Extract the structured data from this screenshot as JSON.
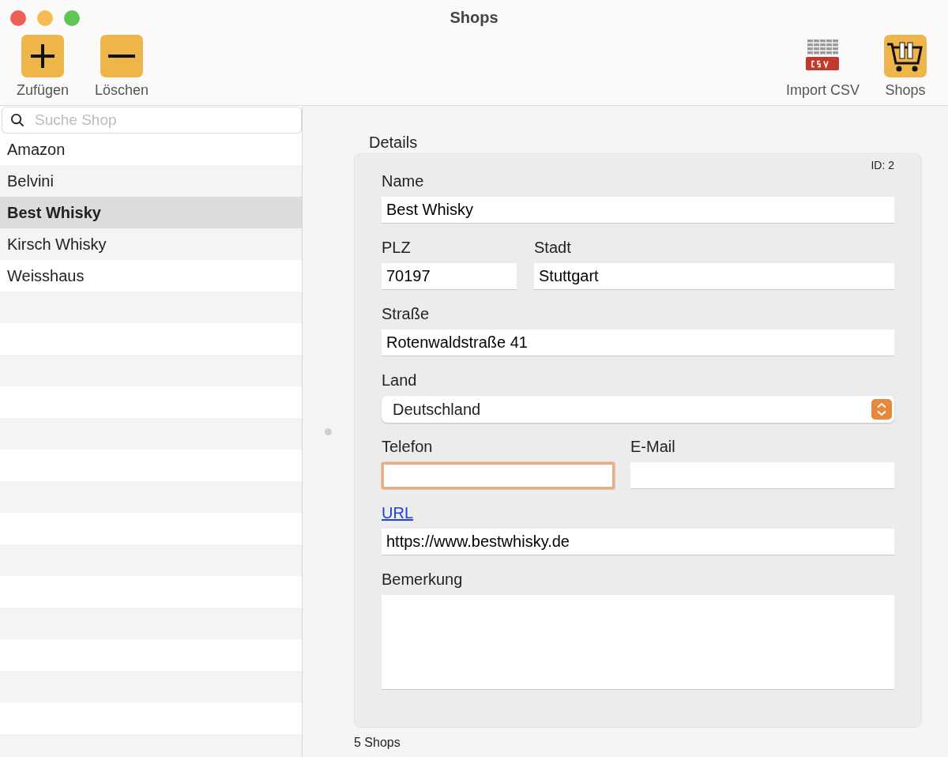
{
  "window": {
    "title": "Shops"
  },
  "toolbar": {
    "left": [
      {
        "kind": "add",
        "label": "Zufügen"
      },
      {
        "kind": "remove",
        "label": "Löschen"
      }
    ],
    "right": [
      {
        "kind": "csv",
        "label": "Import CSV"
      },
      {
        "kind": "cart",
        "label": "Shops"
      }
    ]
  },
  "sidebar": {
    "search": {
      "placeholder": "Suche Shop"
    },
    "items": [
      {
        "label": "Amazon",
        "selected": false
      },
      {
        "label": "Belvini",
        "selected": false
      },
      {
        "label": "Best Whisky",
        "selected": true
      },
      {
        "label": "Kirsch Whisky",
        "selected": false
      },
      {
        "label": "Weisshaus",
        "selected": false
      }
    ]
  },
  "details": {
    "title": "Details",
    "id": "ID: 2",
    "rows": [
      {
        "fields": [
          {
            "kind": "text",
            "label": "Name",
            "value": "Best Whisky",
            "focused": false
          }
        ]
      },
      {
        "fields": [
          {
            "kind": "text",
            "label": "PLZ",
            "value": "70197",
            "focused": false
          },
          {
            "kind": "text",
            "label": "Stadt",
            "value": "Stuttgart",
            "focused": false
          }
        ]
      },
      {
        "fields": [
          {
            "kind": "text",
            "label": "Straße",
            "value": "Rotenwaldstraße 41",
            "focused": false
          }
        ]
      },
      {
        "fields": [
          {
            "kind": "select",
            "label": "Land",
            "value": "Deutschland"
          }
        ]
      },
      {
        "fields": [
          {
            "kind": "text",
            "label": "Telefon",
            "focused": true
          },
          {
            "kind": "text",
            "label": "E-Mail",
            "focused": false
          }
        ]
      },
      {
        "fields": [
          {
            "kind": "link",
            "label": "URL",
            "value": "https://www.bestwhisky.de",
            "focused": false
          }
        ]
      },
      {
        "fields": [
          {
            "kind": "textarea",
            "label": "Bemerkung",
            "focused": false
          }
        ]
      }
    ]
  },
  "status_bar": "5 Shops"
}
